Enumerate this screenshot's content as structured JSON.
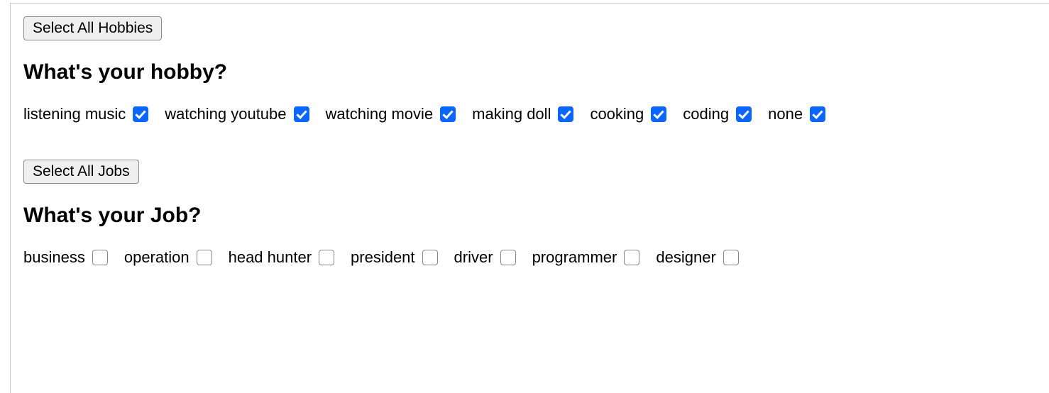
{
  "hobbies": {
    "select_all_label": "Select All Hobbies",
    "heading": "What's your hobby?",
    "items": [
      {
        "label": "listening music",
        "checked": true
      },
      {
        "label": "watching youtube",
        "checked": true
      },
      {
        "label": "watching movie",
        "checked": true
      },
      {
        "label": "making doll",
        "checked": true
      },
      {
        "label": "cooking",
        "checked": true
      },
      {
        "label": "coding",
        "checked": true
      },
      {
        "label": "none",
        "checked": true
      }
    ]
  },
  "jobs": {
    "select_all_label": "Select All Jobs",
    "heading": "What's your Job?",
    "items": [
      {
        "label": "business",
        "checked": false
      },
      {
        "label": "operation",
        "checked": false
      },
      {
        "label": "head hunter",
        "checked": false
      },
      {
        "label": "president",
        "checked": false
      },
      {
        "label": "driver",
        "checked": false
      },
      {
        "label": "programmer",
        "checked": false
      },
      {
        "label": "designer",
        "checked": false
      }
    ]
  }
}
